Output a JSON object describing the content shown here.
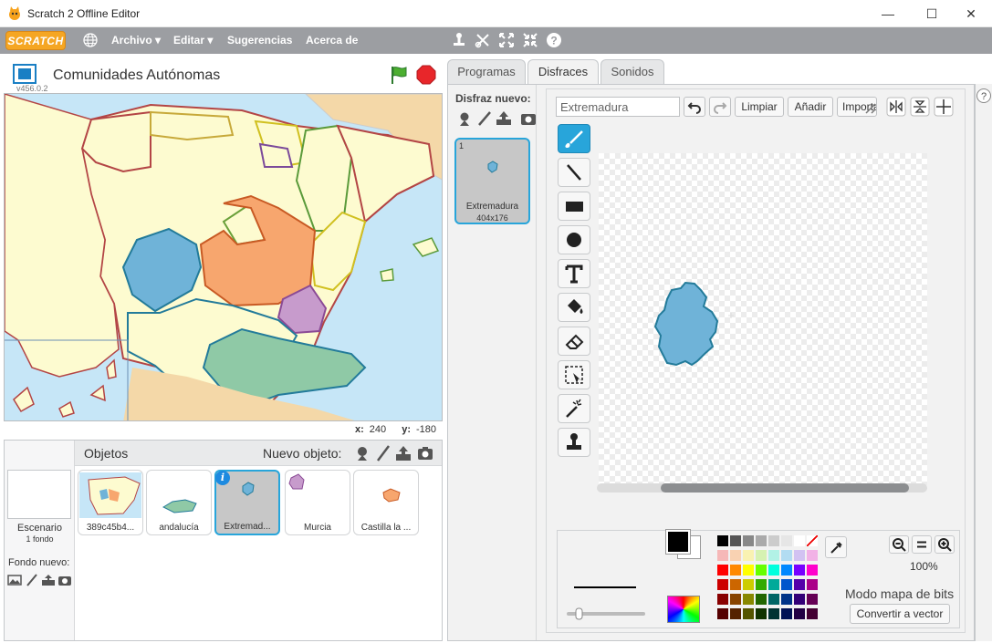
{
  "window": {
    "title": "Scratch 2 Offline Editor",
    "minimize": "—",
    "maximize": "☐",
    "close": "✕"
  },
  "menu": {
    "logo": "SCRATCH",
    "items": [
      "Archivo ▾",
      "Editar ▾",
      "Sugerencias",
      "Acerca de"
    ]
  },
  "stage": {
    "project_name": "Comunidades Autónomas",
    "version": "v456.0.2",
    "x_label": "x:",
    "x_value": "240",
    "y_label": "y:",
    "y_value": "-180"
  },
  "sprites": {
    "header": "Objetos",
    "new_object": "Nuevo objeto:",
    "stage_label": "Escenario",
    "stage_sub": "1 fondo",
    "new_backdrop": "Fondo nuevo:",
    "list": [
      {
        "name": "389c45b4..."
      },
      {
        "name": "andalucía"
      },
      {
        "name": "Extremad..."
      },
      {
        "name": "Murcia"
      },
      {
        "name": "Castilla la ..."
      }
    ]
  },
  "tabs": [
    "Programas",
    "Disfraces",
    "Sonidos"
  ],
  "costumes": {
    "header": "Disfraz nuevo:",
    "items": [
      {
        "num": "1",
        "name": "Extremadura",
        "size": "404x176"
      }
    ]
  },
  "paint": {
    "costume_name": "Extremadura",
    "buttons": {
      "clear": "Limpiar",
      "add": "Añadir",
      "import": "Importar"
    },
    "zoom": "100%",
    "mode": "Modo mapa de bits",
    "convert": "Convertir a vector"
  },
  "colors": {
    "palette": [
      [
        "#000000",
        "#555555",
        "#888888",
        "#aaaaaa",
        "#cccccc",
        "#e6e6e6",
        "#ffffff",
        "none"
      ],
      [
        "#f6b8b8",
        "#f9d2b2",
        "#f9f2b2",
        "#d6f2b2",
        "#b2f2e6",
        "#b2dcf2",
        "#d2c2f2",
        "#f2b2e6"
      ],
      [
        "#ff0000",
        "#ff8800",
        "#ffff00",
        "#66ff00",
        "#00ffdd",
        "#0088ff",
        "#7700ff",
        "#ff00cc"
      ],
      [
        "#cc0000",
        "#cc6600",
        "#cccc00",
        "#33aa00",
        "#00aa99",
        "#0055cc",
        "#5500aa",
        "#aa0088"
      ],
      [
        "#880000",
        "#884400",
        "#888800",
        "#226600",
        "#006666",
        "#003388",
        "#330077",
        "#660055"
      ],
      [
        "#550000",
        "#552200",
        "#555500",
        "#113300",
        "#003333",
        "#001155",
        "#220044",
        "#440033"
      ]
    ],
    "primary": "#000000",
    "secondary": "#ffffff",
    "accent": "#28a5da",
    "extremadura": "#6fb3d8"
  }
}
